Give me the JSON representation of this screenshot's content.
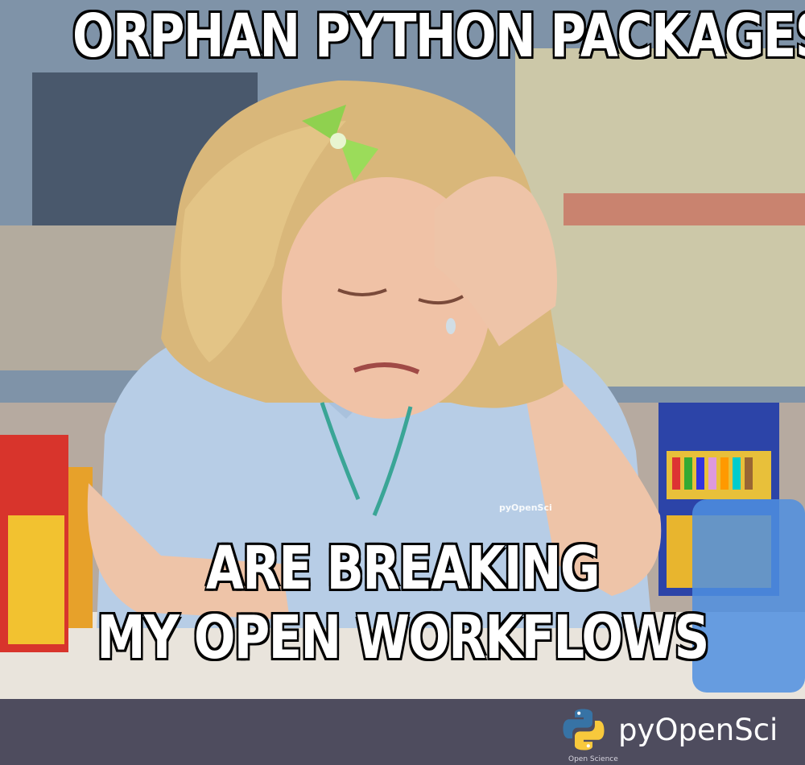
{
  "meme": {
    "top_text": "ORPHAN PYTHON PACKAGES",
    "bottom_line_1": "ARE BREAKING",
    "bottom_line_2": "MY OPEN WORKFLOWS"
  },
  "watermark": "pyOpenSci",
  "footer": {
    "brand_name": "pyOpenSci",
    "brand_tagline": "Open Science"
  },
  "colors": {
    "footer_bg": "#4e4c5e",
    "python_blue": "#3773a5",
    "python_yellow": "#f8c93c"
  }
}
